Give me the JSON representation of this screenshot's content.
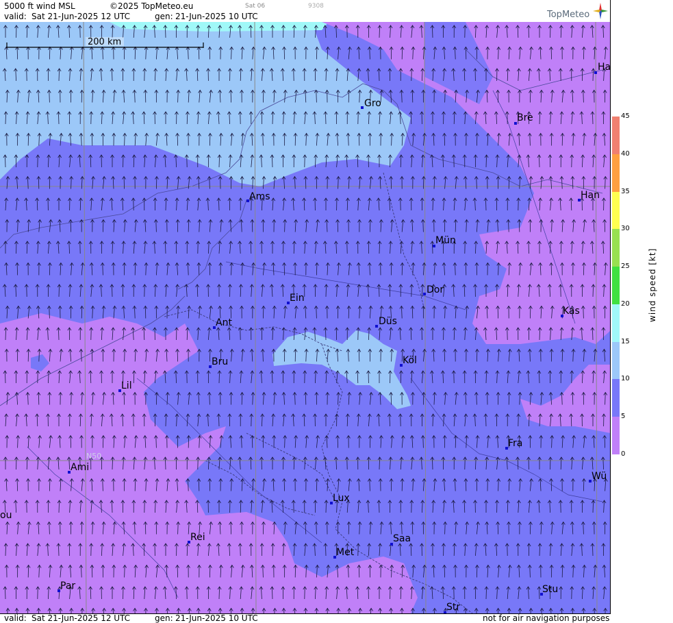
{
  "header": {
    "title": "5000 ft wind MSL",
    "copyright": "©2025 TopMeteo.eu",
    "run_tag": "Sat 06",
    "code": "9308",
    "valid_label": "valid:",
    "valid_time": "Sat  21-Jun-2025  12 UTC",
    "gen_label": "gen:",
    "gen_time": "21-Jun-2025 10 UTC",
    "logo": "TopMeteo"
  },
  "footer": {
    "valid_label": "valid:",
    "valid_time": "Sat  21-Jun-2025  12 UTC",
    "gen_label": "gen:",
    "gen_time": "21-Jun-2025 10 UTC",
    "disclaimer": "not for air navigation purposes"
  },
  "map": {
    "scale_label": "200 km",
    "grid_label": "N50",
    "cities": [
      {
        "name": "Ha"
      },
      {
        "name": "Gro"
      },
      {
        "name": "Bre"
      },
      {
        "name": "Ams"
      },
      {
        "name": "Han"
      },
      {
        "name": "Mün"
      },
      {
        "name": "Dor"
      },
      {
        "name": "Ein"
      },
      {
        "name": "Kas"
      },
      {
        "name": "Ant"
      },
      {
        "name": "Düs"
      },
      {
        "name": "Bru"
      },
      {
        "name": "Köl"
      },
      {
        "name": "Lil"
      },
      {
        "name": "Fra"
      },
      {
        "name": "Ami"
      },
      {
        "name": "Wü"
      },
      {
        "name": "Lux"
      },
      {
        "name": "ou"
      },
      {
        "name": "Rei"
      },
      {
        "name": "Saa"
      },
      {
        "name": "Met"
      },
      {
        "name": "Stu"
      },
      {
        "name": "Par"
      },
      {
        "name": "Str"
      }
    ],
    "wind_direction": "northward arrows across the whole field"
  },
  "legend": {
    "title": "wind  speed  [kt]",
    "ticks": [
      "45",
      "40",
      "35",
      "30",
      "25",
      "20",
      "15",
      "10",
      "5",
      "0"
    ],
    "colors": [
      "#f08070",
      "#ffa040",
      "#ffff50",
      "#98e050",
      "#40e040",
      "#a0f8f8",
      "#9cc8f8",
      "#7878f8",
      "#c080f8"
    ]
  }
}
